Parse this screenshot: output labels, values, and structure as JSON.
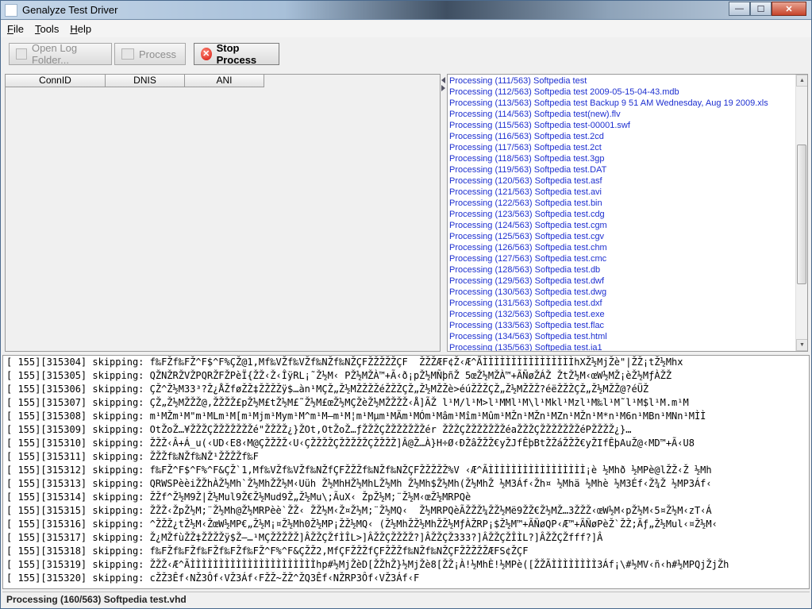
{
  "window": {
    "title": "Genalyze Test Driver",
    "controls": {
      "minimize": "—",
      "maximize": "☐",
      "close": "✕"
    }
  },
  "menu": [
    {
      "accel": "F",
      "rest": "ile"
    },
    {
      "accel": "T",
      "rest": "ools"
    },
    {
      "accel": "H",
      "rest": "elp"
    }
  ],
  "toolbar": {
    "open_log": "Open Log Folder...",
    "process": "Process",
    "stop_process": "Stop Process"
  },
  "table": {
    "columns": [
      "ConnID",
      "DNIS",
      "ANI"
    ]
  },
  "processing_log": [
    "Processing (111/563) Softpedia test",
    "Processing (112/563) Softpedia test 2009-05-15-04-43.mdb",
    "Processing (113/563) Softpedia test Backup 9 51 AM Wednesday, Aug 19 2009.xls",
    "Processing (114/563) Softpedia test(new).flv",
    "Processing (115/563) Softpedia test-00001.swf",
    "Processing (116/563) Softpedia test.2cd",
    "Processing (117/563) Softpedia test.2ct",
    "Processing (118/563) Softpedia test.3gp",
    "Processing (119/563) Softpedia test.DAT",
    "Processing (120/563) Softpedia test.asf",
    "Processing (121/563) Softpedia test.avi",
    "Processing (122/563) Softpedia test.bin",
    "Processing (123/563) Softpedia test.cdg",
    "Processing (124/563) Softpedia test.cgm",
    "Processing (125/563) Softpedia test.cgv",
    "Processing (126/563) Softpedia test.chm",
    "Processing (127/563) Softpedia test.cmc",
    "Processing (128/563) Softpedia test.db",
    "Processing (129/563) Softpedia test.dwf",
    "Processing (130/563) Softpedia test.dwg",
    "Processing (131/563) Softpedia test.dxf",
    "Processing (132/563) Softpedia test.exe",
    "Processing (133/563) Softpedia test.flac",
    "Processing (134/563) Softpedia test.html",
    "Processing (135/563) Softpedia test.ia1"
  ],
  "console_lines": [
    "[ 155][315304] skipping: f‰FŽf‰FŽ^F$^F%ÇŽ@1,Mf‰VŽf‰VŽf‰NŽf‰NŽÇFŽŽŽŽŽÇF  ŽŽŽÆF¢Ž‹Æ^ÃÌÌÌÌÌÌÌÌÌÌÌÌÌÌÌÌhXŽ½MjŽè\"|ŽŽ¡tŽ½Mhx",
    "[ 155][315305] skipping: QŽNŽRŽVŽPQRŽFŽPèÏ{ŽŽ‹Ž‹ÎÿRL¡˜Ž½M‹ PŽ½MŽÀ™+Ã‹ð¡pŽ½MÑþñŽ 5œŽ½MŽÀ™+ÃÑøŽÁŽ ŽtŽ½M‹œW½MŽ¡èŽ½MƒÀŽŽ",
    "[ 155][315306] skipping: ÇŽ^Ž½M33³?Ž¿ÅŽføŽŽ‡ŽŽŽŽÿ$…àn¹MÇŽ„Ž½MŽŽŽŽéŽŽŽÇŽ„Ž½MŽŽè>éúŽŽŽÇŽ„Ž½MŽŽŽ?éëŽŽŽÇŽ„Ž½MŽŽ@?éÜŽ",
    "[ 155][315307] skipping: ÇŽ„Ž½MŽŽŽ@,ŽŽŽŽ£pŽ½M£tŽ½M£˜Ž½M£œŽ½MÇŽèŽ½MŽŽŽŽ‹Å]ÃŽ l¹M/l¹M>l¹MMl¹M\\l¹Mkl¹Mzl¹M‰l¹M˜l¹M$l¹M.m¹M",
    "[ 155][315308] skipping: m¹MŽm¹M\"m¹MLm¹M[m¹Mjm¹Mym¹M^m¹M—m¹M¦m¹Mµm¹MÄm¹MÓm¹Mâm¹Mîm¹Mûm¹MŽn¹MŽn¹MZn¹MŽn¹M*n¹M6n¹MBn¹MNn¹MÌÌ",
    "[ 155][315309] skipping: OtŽoŽ…¥ŽŽŽÇŽŽŽŽŽŽŽé\"ŽŽŽŽ¿}ŽOt,OtŽoŽ…ƒŽŽŽÇŽŽŽŽŽŽŽér ŽŽŽÇŽŽŽŽŽŽŽéaŽŽŽÇŽŽŽŽŽŽŽéPŽŽŽŽ¿}…",
    "[ 155][315310] skipping: ŽŽŽ‹Â+Á_u(‹UD‹E8‹M@ÇŽŽŽŽ‹U‹ÇŽŽŽŽÇŽŽŽŽŽÇŽŽŽŽ]Â@Ž…À}H÷Ø‹ÐŽâŽŽŽ€yŽJfÊþBtŽŽáŽŽŽ€yŽIfÊþAuŽ@‹MD™+Ã‹U8",
    "[ 155][315311] skipping: ŽŽŽf‰NŽf‰NŽ¹ŽŽŽŽf‰F",
    "[ 155][315312] skipping: f‰FŽ^F$^F%^F&ÇŽ`1,Mf‰VŽf‰VŽf‰NŽfÇFŽŽŽf‰NŽf‰NŽÇFŽŽŽŽŽ%V ‹Æ^ÃÌÌÌÌÌÌÌÌÌÌÌÌÌÌÌÌÌ¡è ½Mhð ½MPè@lŽŽ‹Ž ½Mh",
    "[ 155][315313] skipping: QRWSPèèiŽŽhÀŽ½Mh`Ž½MhŽŽ½M‹Uüh Ž½MhHŽ½MhLŽ½Mh Ž½Mh$Ž½Mh(Ž½MhŽ ½M3Áf‹Žh¤ ½Mhä ½Mhè ½M3Éf‹Ž¾Ž ½MP3Áf‹",
    "[ 155][315314] skipping: ŽŽf^Ž½M9Ž|Ž½Mul9Ž€Ž½Mud9Ž„Ž½Mu\\;ÃuX‹ ŽpŽ½M;¨Ž½M‹œŽ½MRPQè",
    "[ 155][315315] skipping: ŽŽŽ‹ŽpŽ½M;¨Ž½Mh@Ž½MRPèè`ŽŽ‹ ŽŽ½M‹Ž¤Ž½M;¨Ž½MQ‹  Ž½MRPQèÃŽŽŽ¼ŽŽ½Më9ŽŽ€Ž½MŽ…3ŽŽŽ‹œW½M‹pŽ½M‹5¤Ž½M‹zT‹Á",
    "[ 155][315316] skipping: ^ŽŽŽ¿tŽ½M‹ŽœW½MP€„Ž½M¡¤Ž½Mh0Ž½MP¡ŽŽ½MQ‹ (Ž½MhŽŽ½MhŽŽ½MƒÀŽRP¡$Ž½M™+ÃÑøQP‹Æ™+ÃÑøPèŽ`ŽŽ;Ãƒ„Ž½Mul‹¤Ž½M‹",
    "[ 155][315317] skipping: Ž¿MŽfùŽŽ‡ŽŽŽŽÿ$Ž–…¹MÇŽŽŽŽŽ]ÂŽŽÇŽfÌÎL>]ÂŽŽÇŽŽŽŽ?]ÂŽŽÇŽ333?]ÂŽŽÇŽÎÌL?]ÂŽŽÇŽfff?]Â",
    "[ 155][315318] skipping: f‰FŽf‰FŽf‰FŽf‰FŽf‰FŽ^F%^F&ÇŽŽ2,MfÇFŽŽŽfÇFŽŽŽf‰NŽf‰NŽÇFŽŽŽŽŽÆFS¢ŽÇF",
    "[ 155][315319] skipping: ŽŽŽ‹Æ^ÃÌÌÌÌÌÌÌÌÌÌÌÌÌÌÌÌÌÌÌÌÌÌhp#½MjŽèD[ŽŽhŽ}½MjŽè8[ŽŽ¡À!½MhÈ!½MPè([ŽŽÃÌÌÌÌÌÌÌÌ3Áf¡\\#½MV‹ñ‹h#½MPQjŽjŽh",
    "[ 155][315320] skipping: cŽŽ3Êf‹NŽ3Ôf‹VŽ3Áf‹FŽŽ~ŽŽ^ŽQ3Êf‹NŽRP3Ôf‹VŽ3Áf‹F"
  ],
  "status": "Processing (160/563) Softpedia test.vhd"
}
